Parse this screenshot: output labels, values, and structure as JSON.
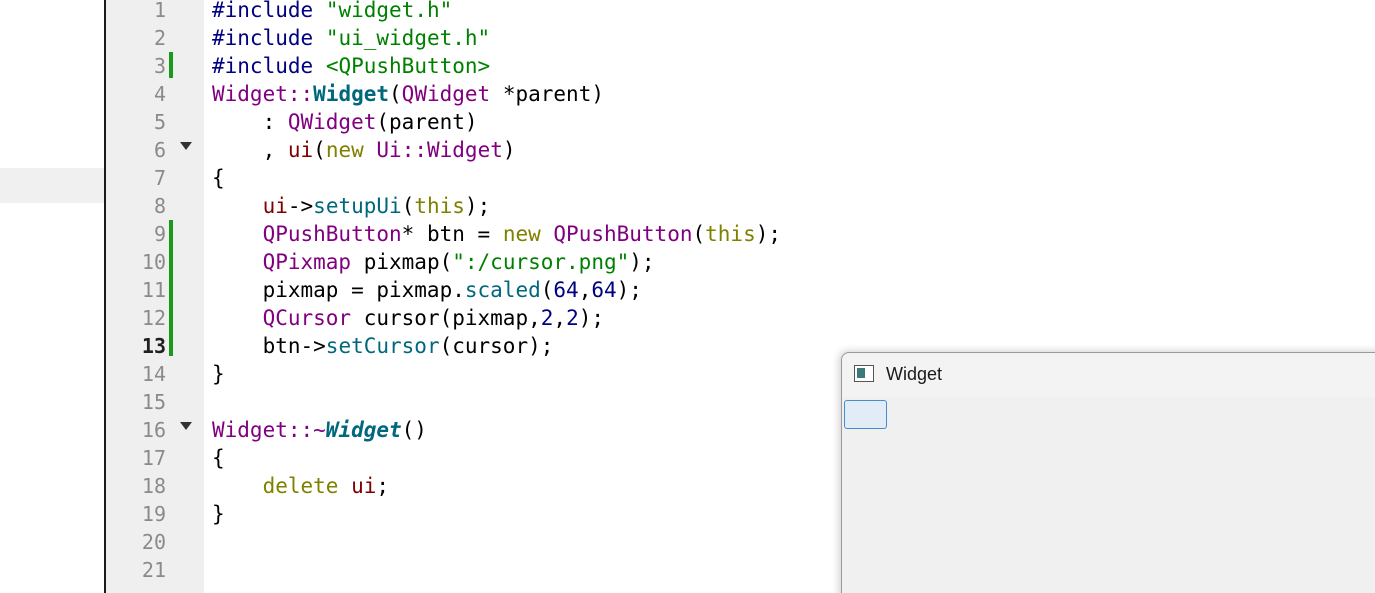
{
  "editor": {
    "line_numbers": [
      "1",
      "2",
      "3",
      "4",
      "5",
      "6",
      "7",
      "8",
      "9",
      "10",
      "11",
      "12",
      "13",
      "14",
      "15",
      "16",
      "17",
      "18",
      "19",
      "20",
      "21"
    ],
    "current_line": "13",
    "code_tokens": {
      "l1": [
        "#include",
        " ",
        "\"widget.h\""
      ],
      "l2": [
        "#include",
        " ",
        "\"ui_widget.h\""
      ],
      "l3": [
        "#include",
        " ",
        "<QPushButton>"
      ],
      "l4": [
        "Widget",
        "::",
        "Widget",
        "(",
        "QWidget",
        " *parent)"
      ],
      "l5": [
        "    : ",
        "QWidget",
        "(parent)"
      ],
      "l6": [
        "    , ",
        "ui",
        "(",
        "new",
        " ",
        "Ui",
        "::",
        "Widget",
        ")"
      ],
      "l7": [
        "{"
      ],
      "l8": [
        "    ",
        "ui",
        "->",
        "setupUi",
        "(",
        "this",
        ");"
      ],
      "l9": [
        "    ",
        "QPushButton",
        "* btn = ",
        "new",
        " ",
        "QPushButton",
        "(",
        "this",
        ");"
      ],
      "l10": [
        "    ",
        "QPixmap",
        " pixmap(",
        "\":/cursor.png\"",
        ");"
      ],
      "l11": [
        "    pixmap = pixmap.",
        "scaled",
        "(",
        "64",
        ",",
        "64",
        ");"
      ],
      "l12": [
        "    ",
        "QCursor",
        " cursor(pixmap,",
        "2",
        ",",
        "2",
        ");"
      ],
      "l13": [
        "    btn->",
        "setCursor",
        "(cursor);"
      ],
      "l14": [
        "}"
      ],
      "l16": [
        "Widget",
        "::~",
        "Widget",
        "()"
      ],
      "l17": [
        "{"
      ],
      "l18": [
        "    ",
        "delete",
        " ",
        "ui",
        ";"
      ],
      "l19": [
        "}"
      ]
    }
  },
  "widget_window": {
    "title": "Widget",
    "button_label": ""
  },
  "colors": {
    "preprocessor": "#000080",
    "string": "#008000",
    "type": "#800080",
    "function": "#00677c",
    "keyword": "#808000",
    "member": "#800000",
    "change_marker": "#1a9a1a",
    "button_bg": "#e1ecf7",
    "button_border": "#4a8bd0"
  }
}
